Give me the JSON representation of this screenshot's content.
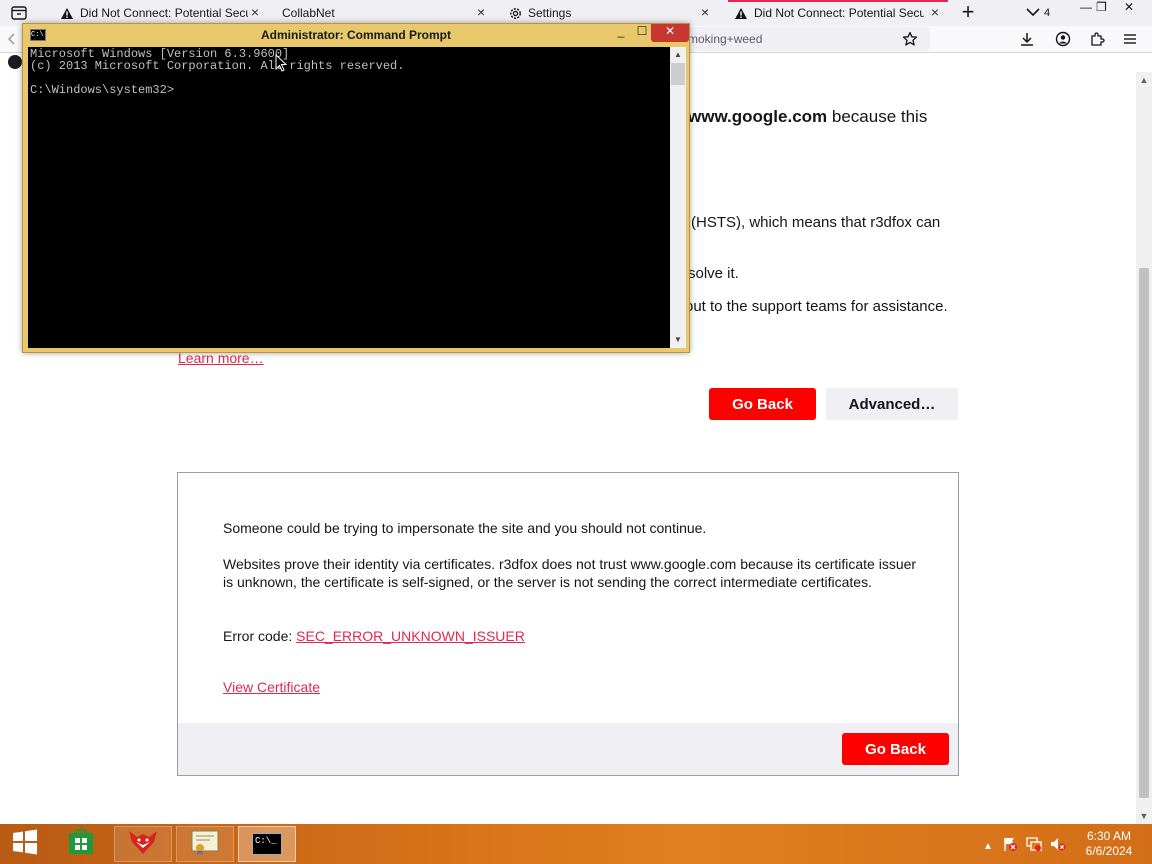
{
  "browser": {
    "tabs": [
      {
        "title": "Did Not Connect: Potential Security Issue",
        "icon": "warning-icon"
      },
      {
        "title": "CollabNet",
        "icon": "none"
      },
      {
        "title": "Settings",
        "icon": "gear-icon"
      },
      {
        "title": "Did Not Connect: Potential Security Issue",
        "icon": "warning-icon",
        "active": true
      }
    ],
    "tab_overflow_count": "4",
    "url_text": "moking+weed",
    "accent_color": "#e22850"
  },
  "page": {
    "heading_bold": "www.google.com",
    "heading_rest": " because this",
    "hsts_text": "(HSTS), which means that r3dfox can",
    "solve_text": "solve it.",
    "support_text": "out to the support teams for assistance.",
    "learn_more": "Learn more…",
    "go_back": "Go Back",
    "advanced": "Advanced…",
    "panel": {
      "warning": "Someone could be trying to impersonate the site and you should not continue.",
      "explanation": "Websites prove their identity via certificates. r3dfox does not trust www.google.com because its certificate issuer is unknown, the certificate is self-signed, or the server is not sending the correct intermediate certificates.",
      "error_label": "Error code: ",
      "error_code": "SEC_ERROR_UNKNOWN_ISSUER",
      "view_certificate": "View Certificate",
      "go_back": "Go Back"
    }
  },
  "cmd": {
    "title": "Administrator: Command Prompt",
    "icon_label": "C:\\",
    "lines": "Microsoft Windows [Version 6.3.9600]\n(c) 2013 Microsoft Corporation. All rights reserved.\n\nC:\\Windows\\system32>"
  },
  "taskbar": {
    "cmd_label": "C:\\_",
    "time": "6:30 AM",
    "date": "6/6/2024"
  }
}
